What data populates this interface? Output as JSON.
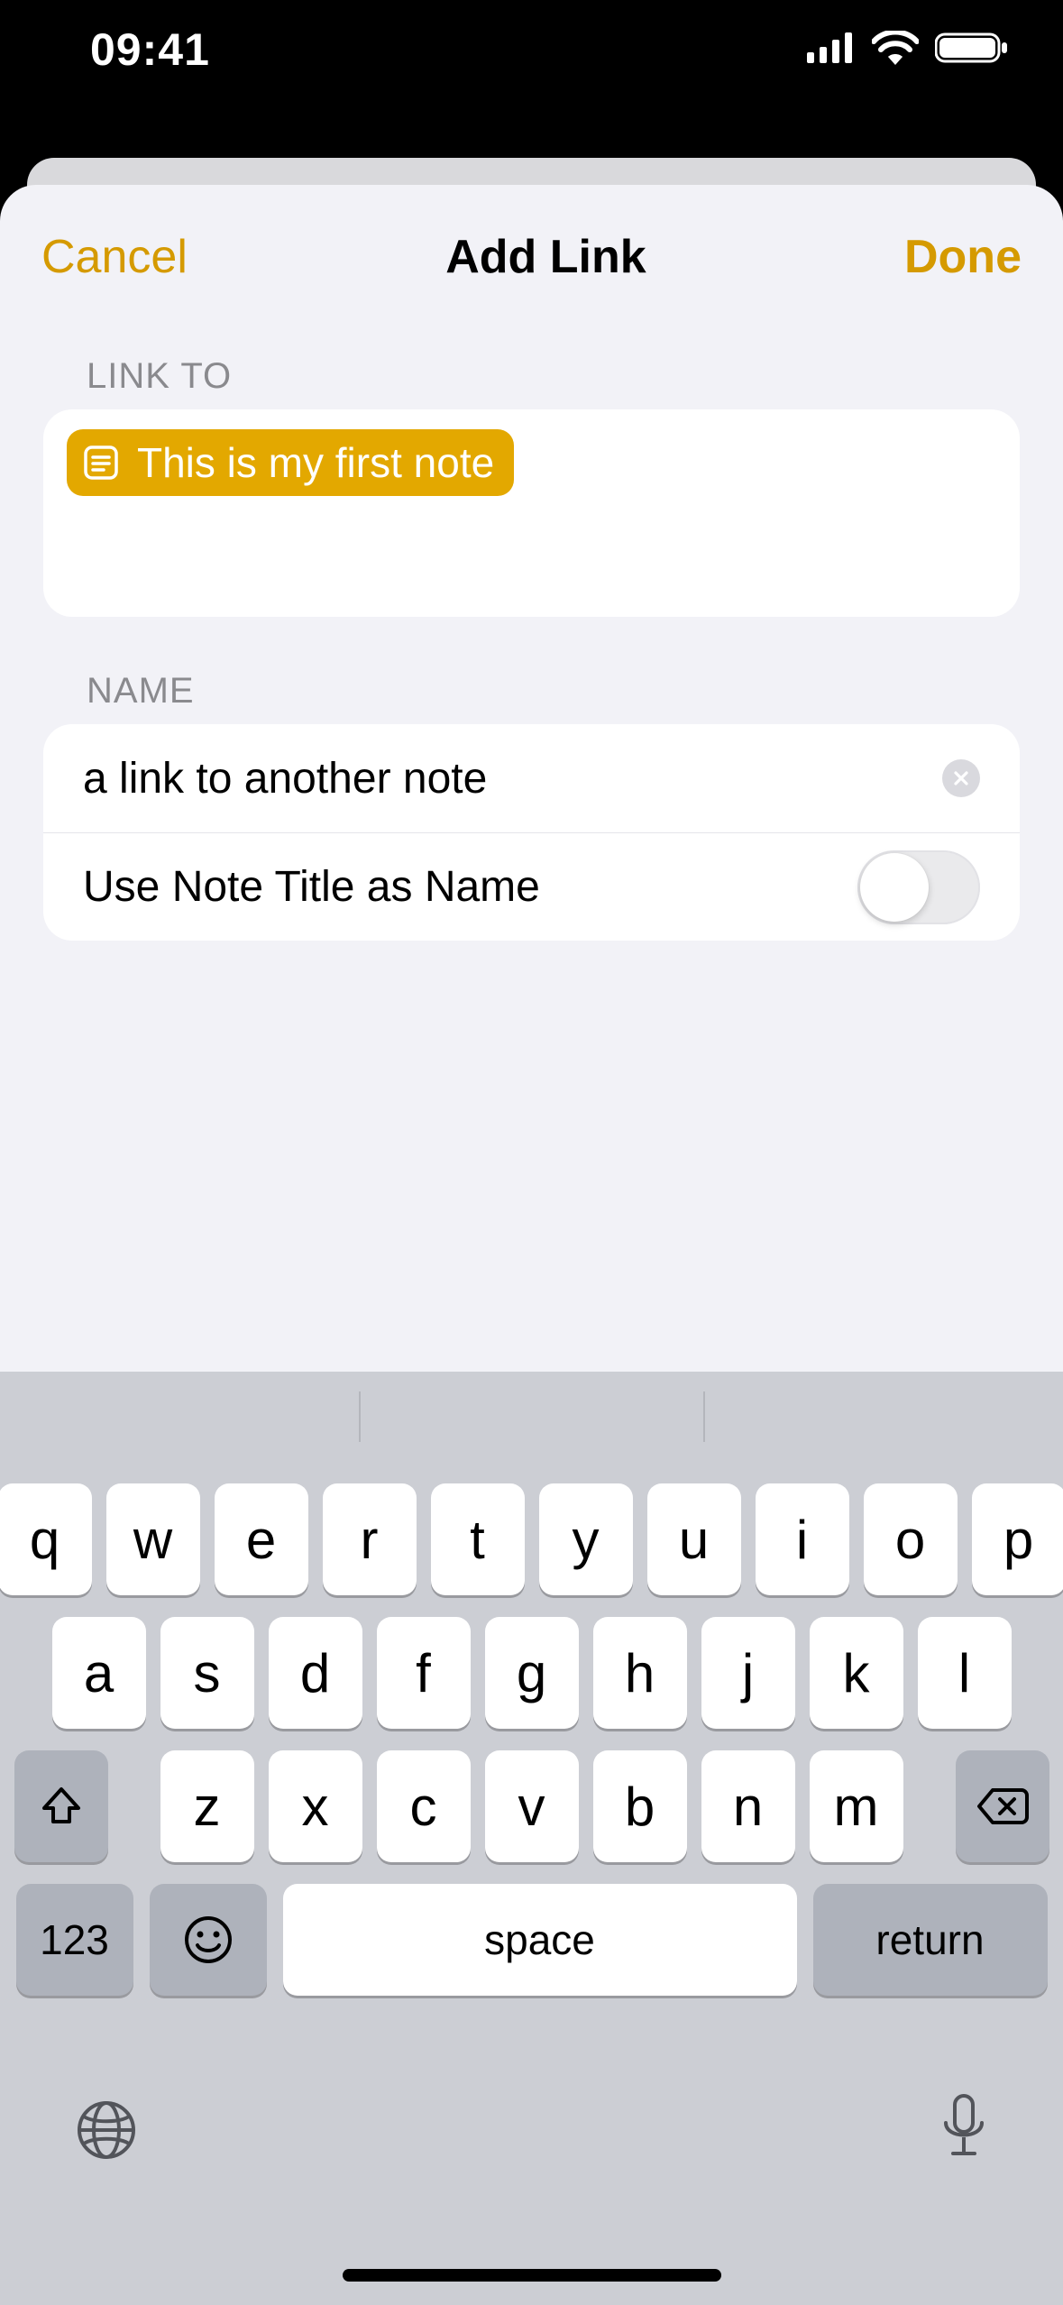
{
  "status": {
    "time": "09:41"
  },
  "nav": {
    "cancel": "Cancel",
    "title": "Add Link",
    "done": "Done"
  },
  "sections": {
    "link_to_label": "LINK TO",
    "name_label": "NAME"
  },
  "link_chip": {
    "text": "This is my first note"
  },
  "name_field": {
    "value": "a link to another note"
  },
  "toggle_row": {
    "label": "Use Note Title as Name",
    "on": false
  },
  "keyboard": {
    "row1": [
      "q",
      "w",
      "e",
      "r",
      "t",
      "y",
      "u",
      "i",
      "o",
      "p"
    ],
    "row2": [
      "a",
      "s",
      "d",
      "f",
      "g",
      "h",
      "j",
      "k",
      "l"
    ],
    "row3": [
      "z",
      "x",
      "c",
      "v",
      "b",
      "n",
      "m"
    ],
    "numbers_key": "123",
    "space_key": "space",
    "return_key": "return"
  }
}
